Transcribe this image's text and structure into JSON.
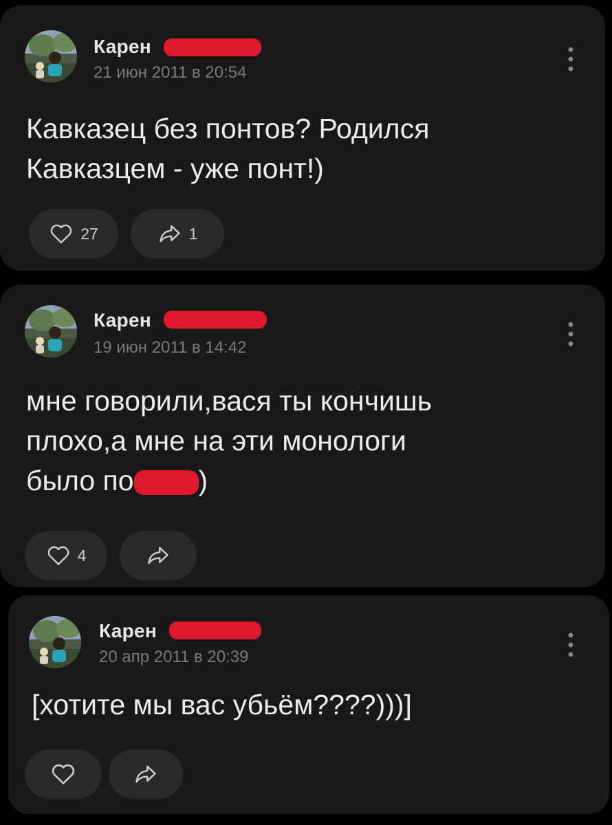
{
  "colors": {
    "background": "#000000",
    "card": "#191919",
    "button": "#2a2a2a",
    "text": "#ececec",
    "muted": "#7a7a7a",
    "redaction": "#e0182d"
  },
  "posts": [
    {
      "author": "Карен",
      "date": "21 июн 2011 в 20:54",
      "text": "Кавказец без понтов? Родился\nКавказцем - уже понт!)",
      "likes": "27",
      "shares": "1",
      "like_icon": "heart-icon",
      "share_icon": "share-arrow-icon",
      "menu_icon": "more-vertical-icon"
    },
    {
      "author": "Карен",
      "date": "19 июн 2011 в 14:42",
      "text_lines": [
        "мне говорили,вася ты кончишь",
        "плохо,а мне на эти монологи"
      ],
      "text_last_prefix": "было по",
      "text_last_suffix": ")",
      "likes": "4",
      "like_icon": "heart-icon",
      "share_icon": "share-arrow-icon",
      "menu_icon": "more-vertical-icon"
    },
    {
      "author": "Карен",
      "date": "20 апр 2011 в 20:39",
      "text": "[хотите мы вас убьём????)))]",
      "like_icon": "heart-icon",
      "share_icon": "share-arrow-icon",
      "menu_icon": "more-vertical-icon"
    }
  ]
}
